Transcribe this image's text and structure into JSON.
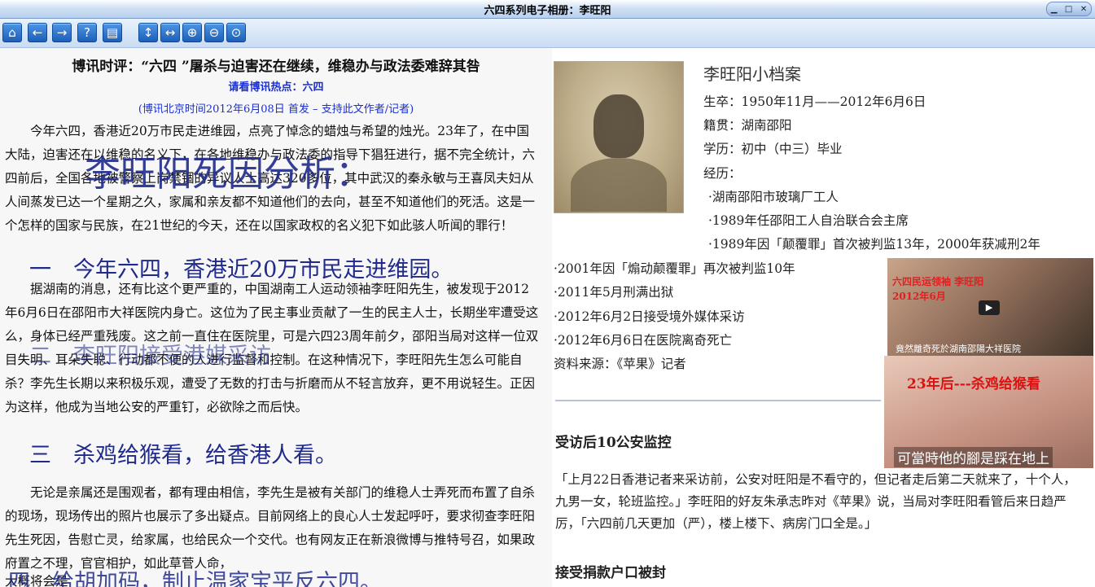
{
  "window": {
    "title": "六四系列电子相册：李旺阳"
  },
  "toolbar": {
    "buttons": [
      {
        "name": "home-icon",
        "glyph": "⌂"
      },
      {
        "name": "back-icon",
        "glyph": "←"
      },
      {
        "name": "forward-icon",
        "glyph": "→"
      },
      {
        "name": "help-icon",
        "glyph": "?"
      },
      {
        "name": "page-icon",
        "glyph": "▤"
      },
      {
        "name": "fit-height-icon",
        "glyph": "↕"
      },
      {
        "name": "fit-width-icon",
        "glyph": "↔"
      },
      {
        "name": "zoom-in-icon",
        "glyph": "⊕"
      },
      {
        "name": "zoom-out-icon",
        "glyph": "⊖"
      },
      {
        "name": "zoom-reset-icon",
        "glyph": "⊙"
      }
    ]
  },
  "article": {
    "title": "博讯时评：“六四 ”屠杀与迫害还在继续，维稳办与政法委难辞其咎",
    "hot_label": "请看博讯热点：",
    "hot_link": "六四",
    "meta_prefix": "(博讯北京时间2012年6月08日 首发 – ",
    "meta_link": "支持此文作者/记者",
    "meta_suffix": ")",
    "para1": "今年六四，香港近20万市民走进维园，点亮了悼念的蜡烛与希望的烛光。23年了，在中国大陆，迫害还在以维稳的名义下，在各地维稳办与政法委的指导下猖狂进行，据不完全统计，六四前后，全国各地被警察上岗禁锢的异议人士高达320多位，其中武汉的秦永敏与王喜凤夫妇从人间蒸发已达一个星期之久，家属和亲友都不知道他们的去向，甚至不知道他们的死活。这是一个怎样的国家与民族，在21世纪的今天，还在以国家政权的名义犯下如此骇人听闻的罪行！",
    "para2": "据湖南的消息，还有比这个更严重的，中国湖南工人运动领袖李旺阳先生，被发现于2012年6月6日在邵阳市大祥医院内身亡。这位为了民主事业贡献了一生的民主人士，长期坐牢遭受这么，身体已经严重残废。这之前一直住在医院里，可是六四23周年前夕，邵阳当局对这样一位双目失明、耳朵失聪、行动都不便的人进行监督和控制。在这种情况下，李旺阳先生怎么可能自杀？李先生长期以来积极乐观，遭受了无数的打击与折磨而从不轻言放弃，更不用说轻生。正因为这样，他成为当地公安的严重钉，必欲除之而后快。",
    "para3": "无论是亲属还是围观者，都有理由相信，李先生是被有关部门的维稳人士弄死而布置了自杀的现场，现场传出的照片也展示了多出疑点。目前网络上的良心人士发起呼吁，要求彻查李旺阳先生死因，告慰亡灵，给家属，也给民众一个交代。也有网友正在新浪微博与推特号召，如果政府置之不理，官官相护，如此草菅人命，",
    "para3_tail": "大概将会是"
  },
  "overlay": {
    "big_title": "李旺阳死因分析：",
    "h1": "一　今年六四，香港近20万市民走进维园。",
    "h2": "二　李旺阳接受港媒采访",
    "h3": "三　杀鸡给猴看，给香港人看。",
    "h4": "四　给胡加码，制止温家宝平反六四。"
  },
  "dossier": {
    "title": "李旺阳小档案",
    "born": "生卒：1950年11月——2012年6月6日",
    "origin": "籍贯：湖南邵阳",
    "edu": "学历：初中（中三）毕业",
    "exp_label": "经历：",
    "items": [
      "·湖南邵阳市玻璃厂工人",
      "·1989年任邵阳工人自治联合会主席",
      "·1989年因「颠覆罪」首次被判监13年，2000年获减刑2年",
      "·2001年因「煽动颠覆罪」再次被判监10年",
      "·2011年5月刑满出狱",
      "·2012年6月2日接受境外媒体采访",
      "·2012年6月6日在医院离奇死亡"
    ],
    "source": "资料来源：《苹果》记者"
  },
  "video": {
    "caption_top": "六四民运领袖 李旺阳",
    "caption_date": "2012年6月",
    "caption_bottom": "竟然離奇死於湖南邵陽大祥医院",
    "play": "▶"
  },
  "photo3": {
    "caption_red": "23年后---杀鸡给猴看",
    "caption_white": "可當時他的腳是踩在地上"
  },
  "section1": {
    "heading": "受访后10公安监控",
    "body": "「上月22日香港记者来采访前，公安对旺阳是不看守的，但记者走后第二天就来了，十个人，九男一女，轮班监控。」李旺阳的好友朱承志昨对《苹果》说，当局对李旺阳看管后来日趋严厉，「六四前几天更加（严），楼上楼下、病房门口全是。」"
  },
  "section2": {
    "heading": "接受捐款户口被封"
  }
}
